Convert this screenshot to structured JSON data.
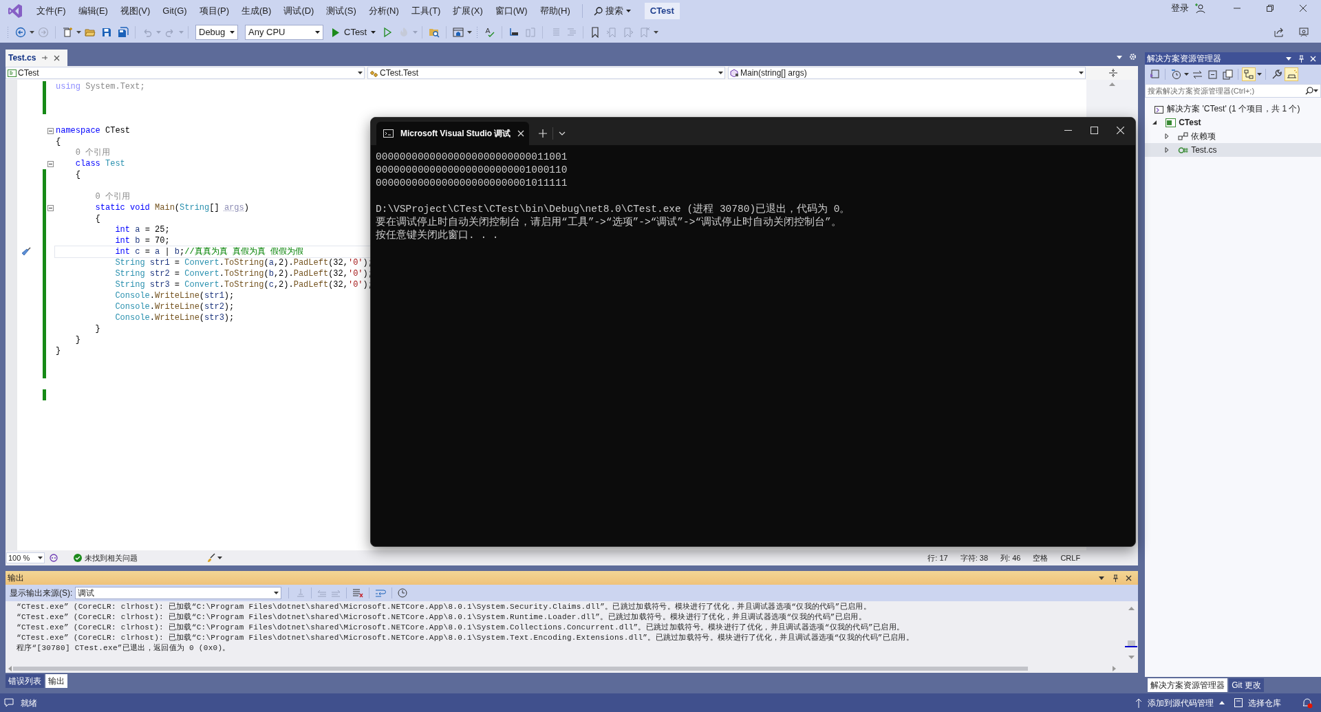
{
  "menu_bar": {
    "items": [
      "文件(F)",
      "编辑(E)",
      "视图(V)",
      "Git(G)",
      "项目(P)",
      "生成(B)",
      "调试(D)",
      "测试(S)",
      "分析(N)",
      "工具(T)",
      "扩展(X)",
      "窗口(W)",
      "帮助(H)"
    ],
    "search": "搜索",
    "solution_name": "CTest",
    "sign_in": "登录"
  },
  "toolbar": {
    "configuration": "Debug",
    "platform": "Any CPU",
    "start_target": "CTest"
  },
  "editor": {
    "tabs": [
      {
        "label": "Test.cs",
        "selected": true
      }
    ],
    "nav": [
      "CTest",
      "CTest.Test",
      "Main(string[] args)"
    ],
    "lines": [
      {
        "kind": "code",
        "changed": true,
        "fold_marker": false,
        "current": false,
        "tokens": [
          {
            "kind": "faded_kw",
            "text": "using"
          },
          {
            "kind": "faded",
            "text": " System.Text;"
          }
        ]
      },
      {
        "kind": "code",
        "changed": true,
        "fold_marker": false,
        "current": false
      },
      {
        "kind": "code",
        "changed": true,
        "fold_marker": false,
        "current": false
      },
      {
        "kind": "code",
        "changed": false,
        "fold_marker": false,
        "current": false
      },
      {
        "kind": "code",
        "changed": false,
        "fold_marker": true,
        "current": false,
        "tokens": [
          {
            "kind": "kw",
            "text": "namespace"
          },
          {
            "kind": "plain",
            "text": " CTest"
          }
        ]
      },
      {
        "kind": "code",
        "changed": false,
        "fold_marker": false,
        "current": false,
        "tokens": [
          {
            "kind": "plain",
            "text": "{"
          }
        ]
      },
      {
        "kind": "codelens",
        "changed": false,
        "fold_marker": false,
        "current": false,
        "text": "    0 个引用"
      },
      {
        "kind": "code",
        "changed": false,
        "fold_marker": true,
        "current": false,
        "tokens": [
          {
            "kind": "kw",
            "text": "    class"
          },
          {
            "kind": "type",
            "text": " Test"
          }
        ]
      },
      {
        "kind": "code",
        "changed": true,
        "fold_marker": false,
        "current": false,
        "tokens": [
          {
            "kind": "plain",
            "text": "    {"
          }
        ]
      },
      {
        "kind": "code",
        "changed": true,
        "fold_marker": false,
        "current": false
      },
      {
        "kind": "codelens",
        "changed": true,
        "fold_marker": false,
        "current": false,
        "text": "        0 个引用"
      },
      {
        "kind": "code",
        "changed": true,
        "fold_marker": true,
        "current": false,
        "tokens": [
          {
            "kind": "kw",
            "text": "        static void"
          },
          {
            "kind": "method",
            "text": " Main"
          },
          {
            "kind": "plain",
            "text": "("
          },
          {
            "kind": "type",
            "text": "String"
          },
          {
            "kind": "plain",
            "text": "[] "
          },
          {
            "kind": "unused",
            "text": "args"
          },
          {
            "kind": "plain",
            "text": ")"
          }
        ]
      },
      {
        "kind": "code",
        "changed": true,
        "fold_marker": false,
        "current": false,
        "tokens": [
          {
            "kind": "plain",
            "text": "        {"
          }
        ]
      },
      {
        "kind": "code",
        "changed": true,
        "fold_marker": false,
        "current": false,
        "tokens": [
          {
            "kind": "kw",
            "text": "            int"
          },
          {
            "kind": "var",
            "text": " a"
          },
          {
            "kind": "plain",
            "text": " = 25;"
          }
        ]
      },
      {
        "kind": "code",
        "changed": true,
        "fold_marker": false,
        "current": false,
        "tokens": [
          {
            "kind": "kw",
            "text": "            int"
          },
          {
            "kind": "var",
            "text": " b"
          },
          {
            "kind": "plain",
            "text": " = 70;"
          }
        ]
      },
      {
        "kind": "code",
        "changed": true,
        "fold_marker": false,
        "current": true,
        "tokens": [
          {
            "kind": "kw",
            "text": "            int"
          },
          {
            "kind": "var",
            "text": " c"
          },
          {
            "kind": "plain",
            "text": " = "
          },
          {
            "kind": "var",
            "text": "a"
          },
          {
            "kind": "plain",
            "text": " | "
          },
          {
            "kind": "var",
            "text": "b"
          },
          {
            "kind": "plain",
            "text": ";"
          },
          {
            "kind": "comment",
            "text": "//真真为真 真假为真 假假为假"
          }
        ]
      },
      {
        "kind": "code",
        "changed": true,
        "fold_marker": false,
        "current": false,
        "tokens": [
          {
            "kind": "type",
            "text": "            String"
          },
          {
            "kind": "var",
            "text": " str1"
          },
          {
            "kind": "plain",
            "text": " = "
          },
          {
            "kind": "type",
            "text": "Convert"
          },
          {
            "kind": "plain",
            "text": "."
          },
          {
            "kind": "method",
            "text": "ToString"
          },
          {
            "kind": "plain",
            "text": "("
          },
          {
            "kind": "var",
            "text": "a"
          },
          {
            "kind": "plain",
            "text": ",2)."
          },
          {
            "kind": "method",
            "text": "PadLeft"
          },
          {
            "kind": "plain",
            "text": "(32,"
          },
          {
            "kind": "str",
            "text": "'0'"
          },
          {
            "kind": "plain",
            "text": ");"
          }
        ]
      },
      {
        "kind": "code",
        "changed": true,
        "fold_marker": false,
        "current": false,
        "tokens": [
          {
            "kind": "type",
            "text": "            String"
          },
          {
            "kind": "var",
            "text": " str2"
          },
          {
            "kind": "plain",
            "text": " = "
          },
          {
            "kind": "type",
            "text": "Convert"
          },
          {
            "kind": "plain",
            "text": "."
          },
          {
            "kind": "method",
            "text": "ToString"
          },
          {
            "kind": "plain",
            "text": "("
          },
          {
            "kind": "var",
            "text": "b"
          },
          {
            "kind": "plain",
            "text": ",2)."
          },
          {
            "kind": "method",
            "text": "PadLeft"
          },
          {
            "kind": "plain",
            "text": "(32,"
          },
          {
            "kind": "str",
            "text": "'0'"
          },
          {
            "kind": "plain",
            "text": ");"
          }
        ]
      },
      {
        "kind": "code",
        "changed": true,
        "fold_marker": false,
        "current": false,
        "tokens": [
          {
            "kind": "type",
            "text": "            String"
          },
          {
            "kind": "var",
            "text": " str3"
          },
          {
            "kind": "plain",
            "text": " = "
          },
          {
            "kind": "type",
            "text": "Convert"
          },
          {
            "kind": "plain",
            "text": "."
          },
          {
            "kind": "method",
            "text": "ToString"
          },
          {
            "kind": "plain",
            "text": "("
          },
          {
            "kind": "var",
            "text": "c"
          },
          {
            "kind": "plain",
            "text": ",2)."
          },
          {
            "kind": "method",
            "text": "PadLeft"
          },
          {
            "kind": "plain",
            "text": "(32,"
          },
          {
            "kind": "str",
            "text": "'0'"
          },
          {
            "kind": "plain",
            "text": ");"
          }
        ]
      },
      {
        "kind": "code",
        "changed": true,
        "fold_marker": false,
        "current": false,
        "tokens": [
          {
            "kind": "type",
            "text": "            Console"
          },
          {
            "kind": "plain",
            "text": "."
          },
          {
            "kind": "method",
            "text": "WriteLine"
          },
          {
            "kind": "plain",
            "text": "("
          },
          {
            "kind": "var",
            "text": "str1"
          },
          {
            "kind": "plain",
            "text": ");"
          }
        ]
      },
      {
        "kind": "code",
        "changed": true,
        "fold_marker": false,
        "current": false,
        "tokens": [
          {
            "kind": "type",
            "text": "            Console"
          },
          {
            "kind": "plain",
            "text": "."
          },
          {
            "kind": "method",
            "text": "WriteLine"
          },
          {
            "kind": "plain",
            "text": "("
          },
          {
            "kind": "var",
            "text": "str2"
          },
          {
            "kind": "plain",
            "text": ");"
          }
        ]
      },
      {
        "kind": "code",
        "changed": true,
        "fold_marker": false,
        "current": false,
        "tokens": [
          {
            "kind": "type",
            "text": "            Console"
          },
          {
            "kind": "plain",
            "text": "."
          },
          {
            "kind": "method",
            "text": "WriteLine"
          },
          {
            "kind": "plain",
            "text": "("
          },
          {
            "kind": "var",
            "text": "str3"
          },
          {
            "kind": "plain",
            "text": ");"
          }
        ]
      },
      {
        "kind": "code",
        "changed": true,
        "fold_marker": false,
        "current": false,
        "tokens": [
          {
            "kind": "plain",
            "text": "        }"
          }
        ]
      },
      {
        "kind": "code",
        "changed": true,
        "fold_marker": false,
        "current": false,
        "tokens": [
          {
            "kind": "plain",
            "text": "    }"
          }
        ]
      },
      {
        "kind": "code",
        "changed": true,
        "fold_marker": false,
        "current": false,
        "tokens": [
          {
            "kind": "plain",
            "text": "}"
          }
        ]
      },
      {
        "kind": "code",
        "changed": true,
        "fold_marker": false,
        "current": false
      },
      {
        "kind": "code",
        "changed": true,
        "fold_marker": false,
        "current": false
      },
      {
        "kind": "code",
        "changed": false,
        "fold_marker": false,
        "current": false
      },
      {
        "kind": "code",
        "changed": true,
        "fold_marker": false,
        "current": false
      }
    ],
    "status": {
      "zoom": "100 %",
      "issues": "未找到相关问题",
      "position": [
        "行: 17",
        "字符: 38",
        "列: 46",
        "空格",
        "CRLF"
      ]
    }
  },
  "console": {
    "title": "Microsoft Visual Studio 调试",
    "blocks": [
      [
        "00000000000000000000000000011001",
        "00000000000000000000000001000110",
        "00000000000000000000000001011111"
      ],
      [
        "D:\\VSProject\\CTest\\CTest\\bin\\Debug\\net8.0\\CTest.exe (进程 30780)已退出，代码为 0。",
        "要在调试停止时自动关闭控制台，请启用“工具”->“选项”->“调试”->“调试停止时自动关闭控制台”。",
        "按任意键关闭此窗口. . ."
      ]
    ]
  },
  "output_panel": {
    "title": "输出",
    "source_label": "显示输出来源(S):",
    "source": "调试",
    "lines": [
      "“CTest.exe” (CoreCLR: clrhost): 已加载“C:\\Program Files\\dotnet\\shared\\Microsoft.NETCore.App\\8.0.1\\System.Security.Claims.dll”。已跳过加载符号。模块进行了优化，并且调试器选项“仅我的代码”已启用。",
      "“CTest.exe” (CoreCLR: clrhost): 已加载“C:\\Program Files\\dotnet\\shared\\Microsoft.NETCore.App\\8.0.1\\System.Runtime.Loader.dll”。已跳过加载符号。模块进行了优化，并且调试器选项“仅我的代码”已启用。",
      "“CTest.exe” (CoreCLR: clrhost): 已加载“C:\\Program Files\\dotnet\\shared\\Microsoft.NETCore.App\\8.0.1\\System.Collections.Concurrent.dll”。已跳过加载符号。模块进行了优化，并且调试器选项“仅我的代码”已启用。",
      "“CTest.exe” (CoreCLR: clrhost): 已加载“C:\\Program Files\\dotnet\\shared\\Microsoft.NETCore.App\\8.0.1\\System.Text.Encoding.Extensions.dll”。已跳过加载符号。模块进行了优化，并且调试器选项“仅我的代码”已启用。",
      "程序“[30780] CTest.exe”已退出，返回值为 0 (0x0)。"
    ],
    "tabs": [
      {
        "label": "错误列表",
        "selected": false
      },
      {
        "label": "输出",
        "selected": true
      }
    ]
  },
  "solution_explorer": {
    "title": "解决方案资源管理器",
    "search": {
      "placeholder": "搜索解决方案资源管理器(Ctrl+;)"
    },
    "solution": "解决方案 'CTest' (1 个项目，共 1 个)",
    "items": [
      {
        "label": "CTest",
        "kind": "project",
        "expanded": true,
        "selected": false,
        "children": [
          {
            "label": "依赖项",
            "kind": "dependencies",
            "expanded": false,
            "selected": false
          },
          {
            "label": "Test.cs",
            "kind": "file",
            "expanded": false,
            "selected": true
          }
        ]
      }
    ],
    "tabs": [
      {
        "label": "解决方案资源管理器",
        "selected": true
      },
      {
        "label": "Git 更改",
        "selected": false
      }
    ]
  },
  "status_bar": {
    "text": "就绪",
    "source_control": "添加到源代码管理",
    "repository": "选择仓库"
  }
}
